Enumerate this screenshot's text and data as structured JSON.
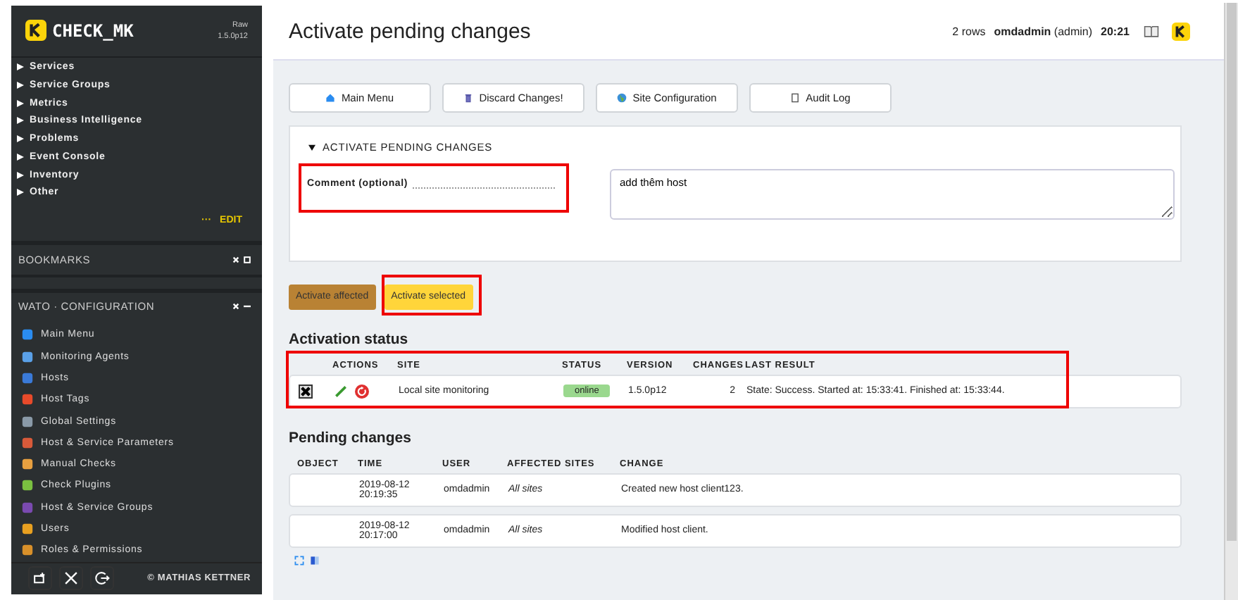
{
  "sidebar": {
    "logo_text": "CHECK_MK",
    "version_label": "Raw",
    "version": "1.5.0p12",
    "views": [
      {
        "label": "Services"
      },
      {
        "label": "Service Groups"
      },
      {
        "label": "Metrics"
      },
      {
        "label": "Business Intelligence"
      },
      {
        "label": "Problems"
      },
      {
        "label": "Event Console"
      },
      {
        "label": "Inventory"
      },
      {
        "label": "Other"
      }
    ],
    "edit_dots": "···",
    "edit": "EDIT",
    "bookmarks": {
      "title": "BOOKMARKS"
    },
    "wato": {
      "title": "WATO · CONFIGURATION",
      "items": [
        {
          "label": "Main Menu",
          "kind": "home"
        },
        {
          "label": "Monitoring Agents",
          "kind": "agent"
        },
        {
          "label": "Hosts",
          "kind": "host"
        },
        {
          "label": "Host Tags",
          "kind": "tag"
        },
        {
          "label": "Global Settings",
          "kind": "gear"
        },
        {
          "label": "Host & Service Parameters",
          "kind": "rules"
        },
        {
          "label": "Manual Checks",
          "kind": "hand"
        },
        {
          "label": "Check Plugins",
          "kind": "plugin"
        },
        {
          "label": "Host & Service Groups",
          "kind": "groups"
        },
        {
          "label": "Users",
          "kind": "users"
        },
        {
          "label": "Roles & Permissions",
          "kind": "role"
        }
      ]
    },
    "copyright": "© MATHIAS KETTNER"
  },
  "header": {
    "title": "Activate pending changes",
    "rows": "2 rows",
    "user": "omdadmin",
    "role": "(admin)",
    "time": "20:21"
  },
  "toolbar": [
    {
      "label": "Main Menu",
      "kind": "home"
    },
    {
      "label": "Discard Changes!",
      "kind": "trash"
    },
    {
      "label": "Site Configuration",
      "kind": "globe"
    },
    {
      "label": "Audit Log",
      "kind": "log"
    }
  ],
  "form": {
    "title": "ACTIVATE PENDING CHANGES",
    "expanded": true,
    "comment_label": "Comment (optional)",
    "comment_highlighted": true,
    "comment_value": "add thêm host"
  },
  "activate_buttons": [
    {
      "label": "Activate affected",
      "selected": false,
      "highlighted": false
    },
    {
      "label": "Activate selected",
      "selected": true,
      "highlighted": true
    }
  ],
  "activation": {
    "title": "Activation status",
    "highlighted": true,
    "columns": [
      "ACTIONS",
      "SITE",
      "STATUS",
      "VERSION",
      "CHANGES",
      "LAST RESULT"
    ],
    "rows": [
      {
        "checked": true,
        "site": "Local site monitoring",
        "status": "online",
        "version": "1.5.0p12",
        "changes": "2",
        "last_result": "State: Success. Started at: 15:33:41. Finished at: 15:33:44."
      }
    ]
  },
  "pending": {
    "title": "Pending changes",
    "columns": [
      "OBJECT",
      "TIME",
      "USER",
      "AFFECTED SITES",
      "CHANGE"
    ],
    "rows": [
      {
        "object": "",
        "time": "2019-08-12 20:19:35",
        "user": "omdadmin",
        "sites": "All sites",
        "change": "Created new host client123."
      },
      {
        "object": "",
        "time": "2019-08-12 20:17:00",
        "user": "omdadmin",
        "sites": "All sites",
        "change": "Modified host client."
      }
    ]
  }
}
